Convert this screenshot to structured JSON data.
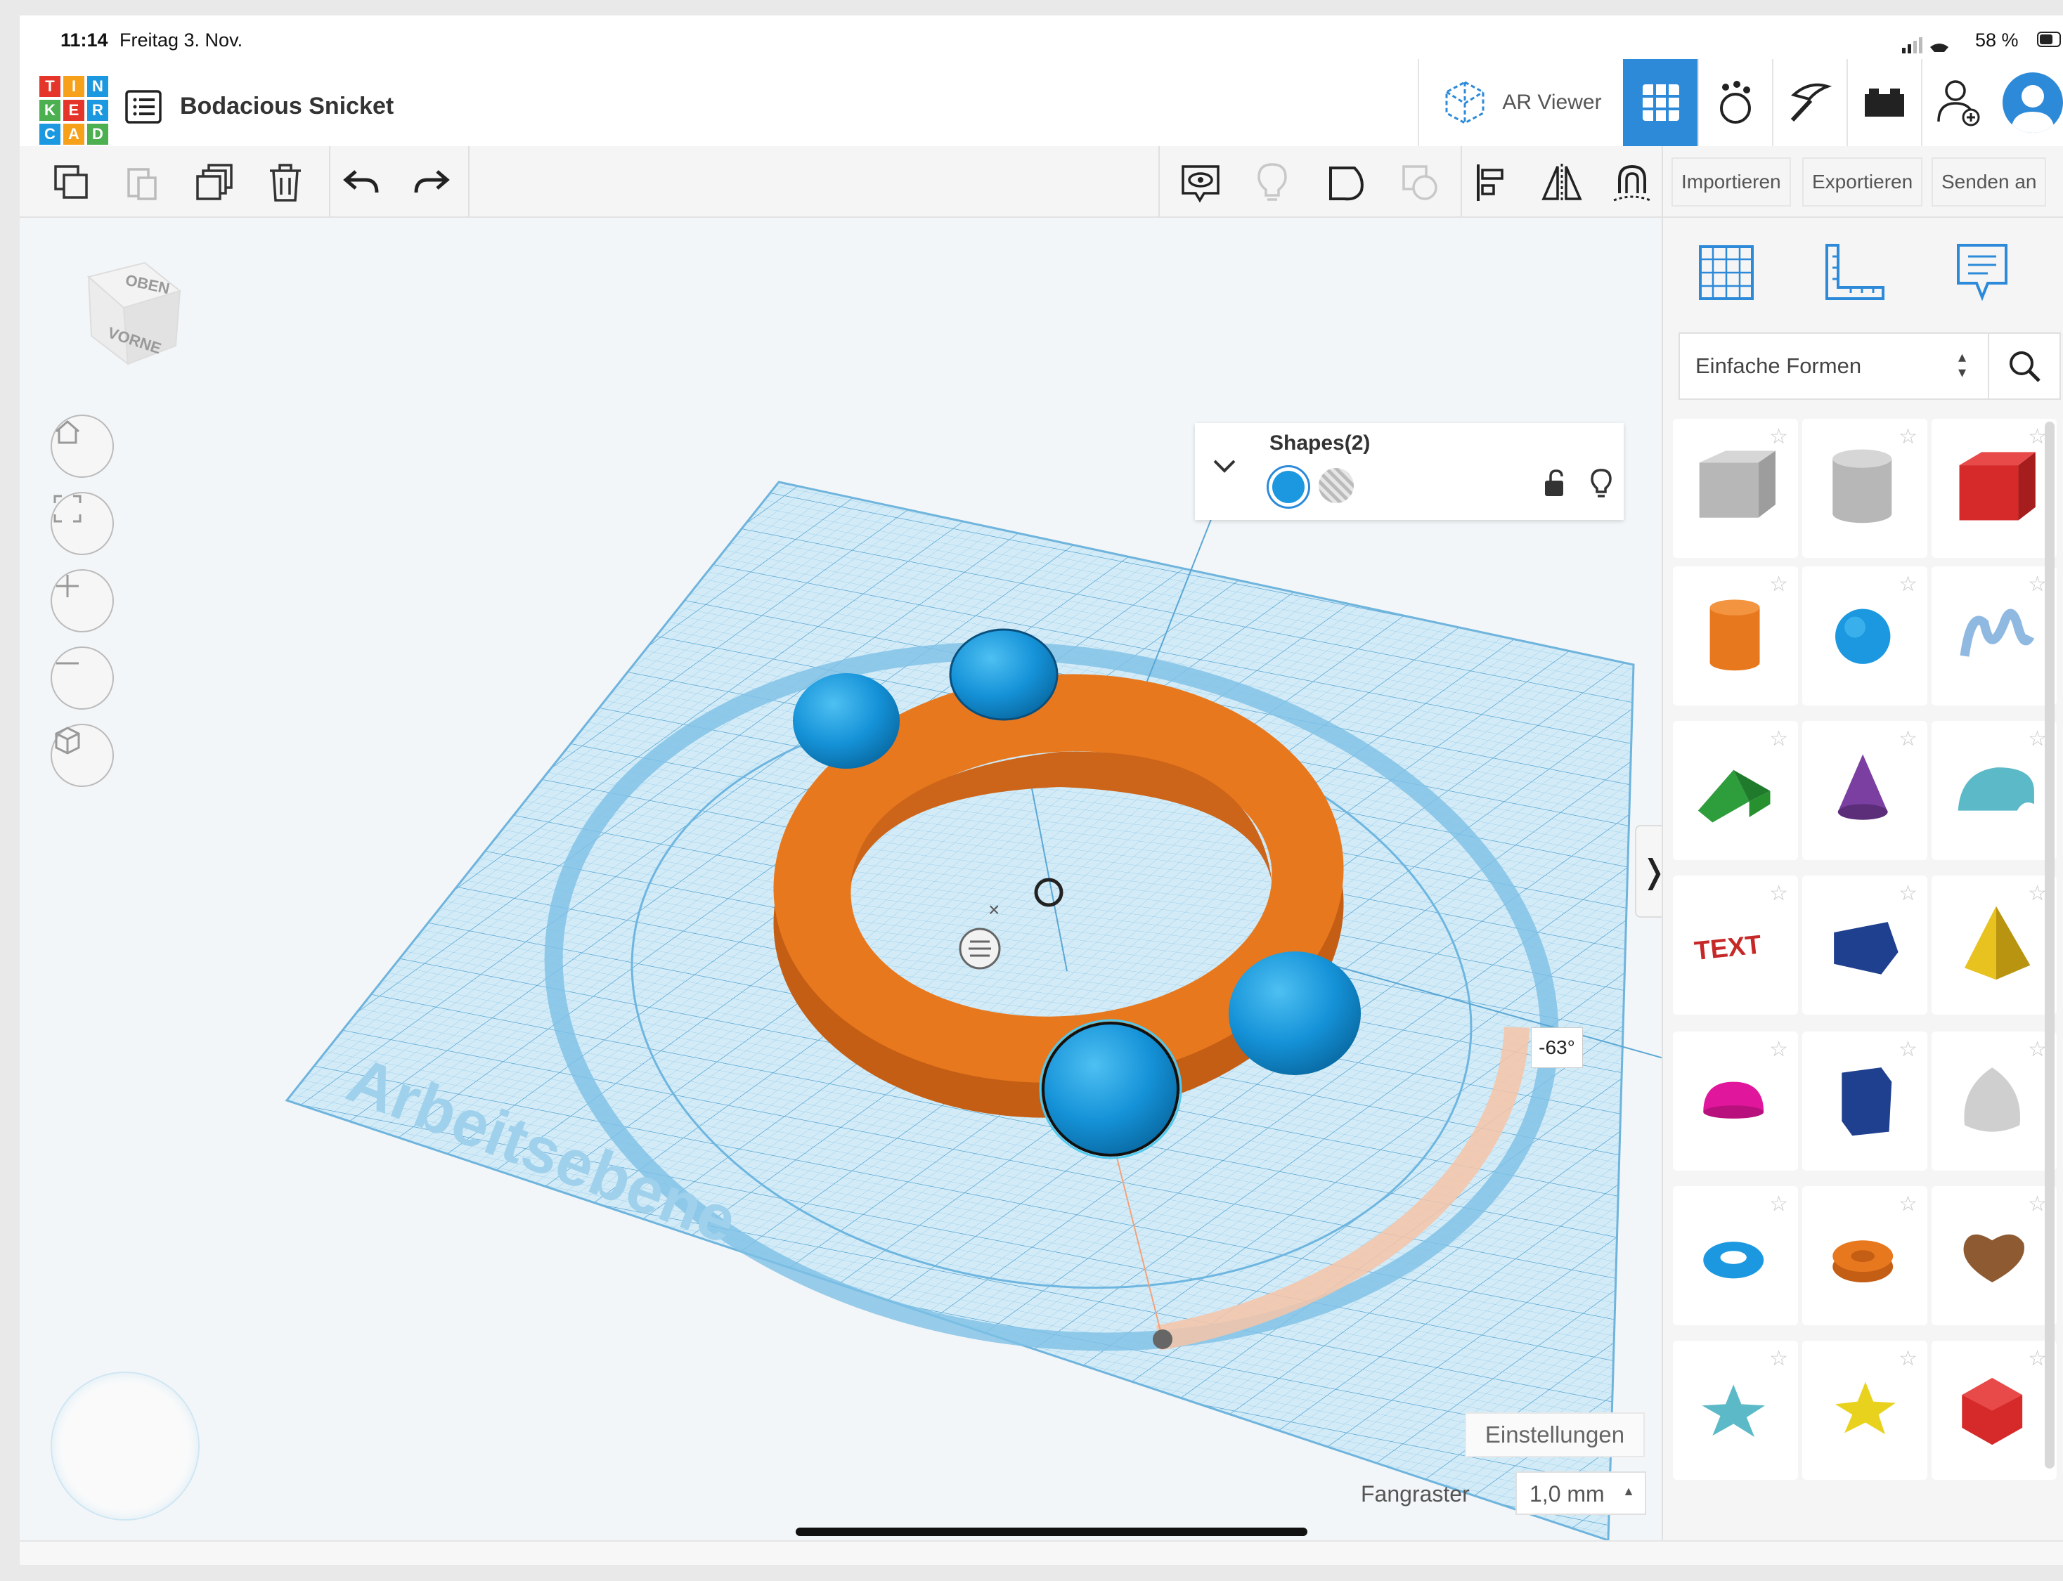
{
  "status_bar": {
    "time": "11:14",
    "date": "Freitag 3. Nov.",
    "battery": "58 %"
  },
  "header": {
    "logo_letters": [
      "T",
      "I",
      "N",
      "K",
      "E",
      "R",
      "C",
      "A",
      "D"
    ],
    "logo_colors": [
      "#e5352b",
      "#f7a11a",
      "#1b98e0",
      "#4caf50",
      "#e5352b",
      "#1b98e0",
      "#1b98e0",
      "#f7a11a",
      "#4caf50"
    ],
    "project_title": "Bodacious Snicket",
    "ar_viewer_label": "AR Viewer",
    "accent": "#2c8ad9"
  },
  "toolbar": {
    "import_label": "Importieren",
    "export_label": "Exportieren",
    "send_label": "Senden an"
  },
  "view_cube": {
    "top_label": "OBEN",
    "front_label": "VORNE"
  },
  "workplane": {
    "label": "Arbeitsebene",
    "angle_readout": "-63°"
  },
  "shapes_panel": {
    "title": "Shapes(2)",
    "solid_color": "#1b98e0"
  },
  "settings": {
    "settings_label": "Einstellungen",
    "snap_label": "Fangraster",
    "snap_value": "1,0 mm"
  },
  "right_panel": {
    "library_select": "Einfache Formen",
    "shapes": [
      {
        "name": "box-hole-icon",
        "color": "#b7b7b7"
      },
      {
        "name": "cylinder-hole-icon",
        "color": "#b7b7b7"
      },
      {
        "name": "box-icon",
        "color": "#d62a2a"
      },
      {
        "name": "cylinder-icon",
        "color": "#e8781e"
      },
      {
        "name": "sphere-icon",
        "color": "#1b98e0"
      },
      {
        "name": "scribble-icon",
        "color": "#8fb9e0"
      },
      {
        "name": "roof-icon",
        "color": "#2e9d3c"
      },
      {
        "name": "cone-icon",
        "color": "#7a3fa0"
      },
      {
        "name": "round-roof-icon",
        "color": "#5bb9c8"
      },
      {
        "name": "text-icon",
        "color": "#c62828"
      },
      {
        "name": "wedge-icon",
        "color": "#1f3f8f"
      },
      {
        "name": "pyramid-icon",
        "color": "#e8c21e"
      },
      {
        "name": "half-sphere-icon",
        "color": "#e0169c"
      },
      {
        "name": "polygon-icon",
        "color": "#1f3f8f"
      },
      {
        "name": "paraboloid-icon",
        "color": "#cfcfcf"
      },
      {
        "name": "torus-icon",
        "color": "#1b98e0"
      },
      {
        "name": "tube-icon",
        "color": "#e8781e"
      },
      {
        "name": "heart-icon",
        "color": "#8d5a32"
      },
      {
        "name": "star-icon",
        "color": "#5bb9c8"
      },
      {
        "name": "star-gold-icon",
        "color": "#e8d21e"
      },
      {
        "name": "icosahedron-icon",
        "color": "#d62a2a"
      }
    ]
  }
}
